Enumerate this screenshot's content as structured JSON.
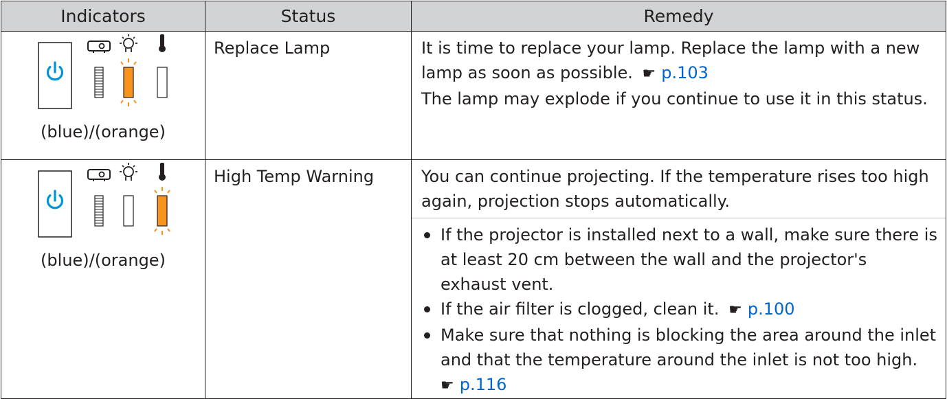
{
  "table": {
    "headers": [
      "Indicators",
      "Status",
      "Remedy"
    ],
    "rows": [
      {
        "color_label": "(blue)/(orange)",
        "status": "Replace Lamp",
        "remedy_lines": [
          "It is time to replace your lamp. Replace the lamp with a new lamp as soon as possible.",
          "The lamp may explode if you continue to use it in this status."
        ],
        "remedy_link": "p.103",
        "lit_indicator": "lamp",
        "indicator_icons": [
          "power-icon",
          "projector-icon",
          "lamp-icon",
          "thermometer-icon"
        ]
      },
      {
        "color_label": "(blue)/(orange)",
        "status": "High Temp Warning",
        "remedy_intro": "You can continue projecting. If the temperature rises too high again, projection stops automatically.",
        "bullets": [
          {
            "text": "If the projector is installed next to a wall, make sure there is at least 20 cm between the wall and the projector's exhaust vent.",
            "link": ""
          },
          {
            "text": "If the air filter is clogged, clean it.",
            "link": "p.100"
          },
          {
            "text": "Make sure that nothing is blocking the area around the inlet and that the temperature around the inlet is not too high.",
            "link": "p.116"
          }
        ],
        "lit_indicator": "temperature",
        "indicator_icons": [
          "power-icon",
          "projector-icon",
          "lamp-icon",
          "thermometer-icon"
        ]
      }
    ]
  },
  "colors": {
    "power_blue": "#0094d5",
    "warning_orange": "#f7941d",
    "link_blue": "#0066cc",
    "header_gray": "#d1d3d4"
  }
}
